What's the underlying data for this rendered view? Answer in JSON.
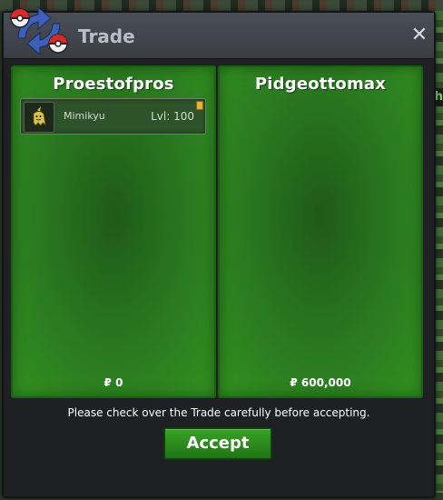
{
  "window": {
    "title": "Trade",
    "close_label": "✕"
  },
  "left_panel": {
    "player_name": "Proestofpros",
    "items": [
      {
        "name": "Mimikyu",
        "level": "Lvl: 100"
      }
    ],
    "money": "₽ 0"
  },
  "right_panel": {
    "player_name": "Pidgeottomax",
    "items": [],
    "money": "₽ 600,000"
  },
  "notice": "Please check over the Trade carefully before accepting.",
  "accept_label": "Accept",
  "colors": {
    "panel_green": "#2a7a20",
    "button_green": "#2b8c1c",
    "window_bg": "#1e2024"
  },
  "icons": {
    "logo": "trade-swap-pokeballs-icon",
    "close": "close-icon",
    "lock": "lock-icon",
    "sprite": "mimikyu-sprite-icon"
  }
}
